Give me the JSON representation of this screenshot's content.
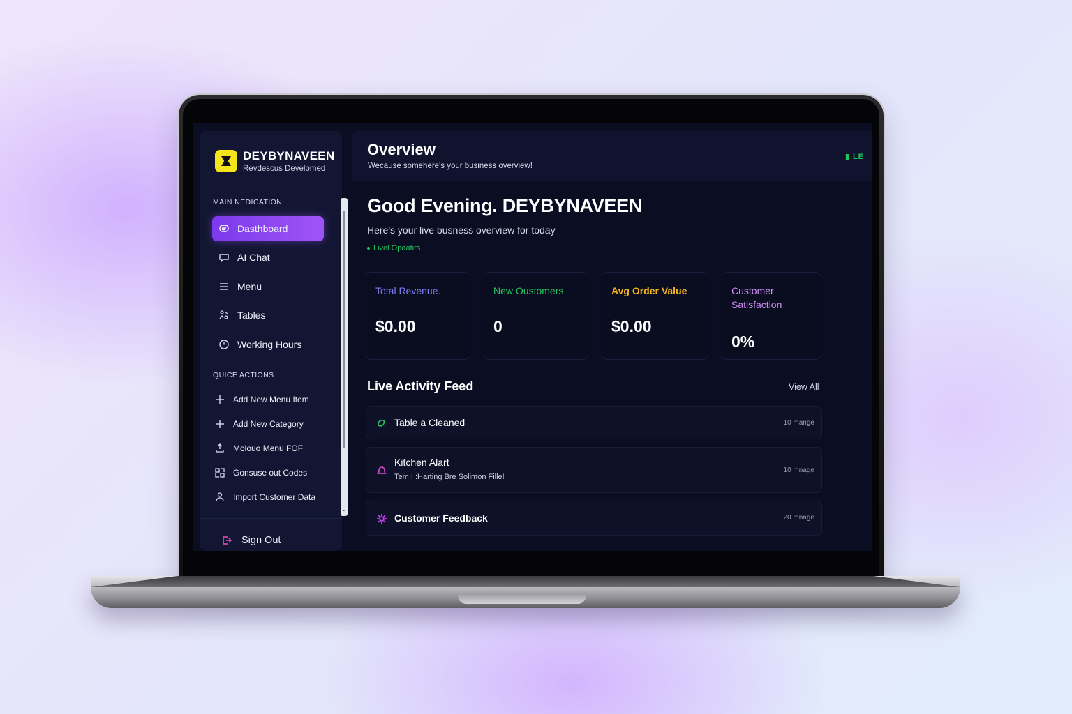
{
  "sidebar": {
    "brand_name": "DEYBYNAVEEN",
    "brand_sub": "Revdescus Develomed",
    "main_section_label": "MAIN NEDICATION",
    "nav": [
      {
        "label": "Dasthboard",
        "icon": "chat-bubble-icon",
        "active": true
      },
      {
        "label": "AI Chat",
        "icon": "message-icon",
        "active": false
      },
      {
        "label": "Menu",
        "icon": "list-icon",
        "active": false
      },
      {
        "label": "Tables",
        "icon": "table-icon",
        "active": false
      },
      {
        "label": "Working Hours",
        "icon": "clock-icon",
        "active": false
      }
    ],
    "quick_section_label": "QUICE ACTIONS",
    "quick_actions": [
      {
        "label": "Add New Menu Item",
        "icon": "plus-icon"
      },
      {
        "label": "Add New Category",
        "icon": "plus-icon"
      },
      {
        "label": "Molouo Menu FOF",
        "icon": "upload-icon"
      },
      {
        "label": "Gonsuse out Codes",
        "icon": "qr-icon"
      },
      {
        "label": "Import Customer Data",
        "icon": "user-import-icon"
      }
    ],
    "sign_out": "Sign Out"
  },
  "header": {
    "title": "Overview",
    "subtitle": "Wecause somehere's your business overview!",
    "badge": "LE"
  },
  "greeting": {
    "title": "Good Evening. DEYBYNAVEEN",
    "subtitle": "Here's your live busness overview for today",
    "live_label": "Livel Opdatirs"
  },
  "stats": [
    {
      "label": "Total Revenue.",
      "value": "$0.00",
      "color": "#7c7cf5"
    },
    {
      "label": "New Oustomers",
      "value": "0",
      "color": "#22c55e"
    },
    {
      "label": "Avg Order Value",
      "value": "$0.00",
      "color": "#f5b31a"
    },
    {
      "label": "Customer Satisfaction",
      "value": "0%",
      "color": "#d08ef5"
    }
  ],
  "feed": {
    "title": "Live Activity Feed",
    "view_all": "View All",
    "items": [
      {
        "title": "Table a Cleaned",
        "detail": "",
        "time": "10 mange",
        "icon": "leaf-icon",
        "color": "#22c55e"
      },
      {
        "title": "Kitchen Alart",
        "detail": "Tem I :Harting Bre Solimon Fille!",
        "time": "10 mnage",
        "icon": "bell-icon",
        "color": "#e04ad8"
      },
      {
        "title": "Customer Feedback",
        "detail": "",
        "time": "20 mnage",
        "icon": "gear-icon",
        "color": "#c040f0"
      }
    ]
  }
}
